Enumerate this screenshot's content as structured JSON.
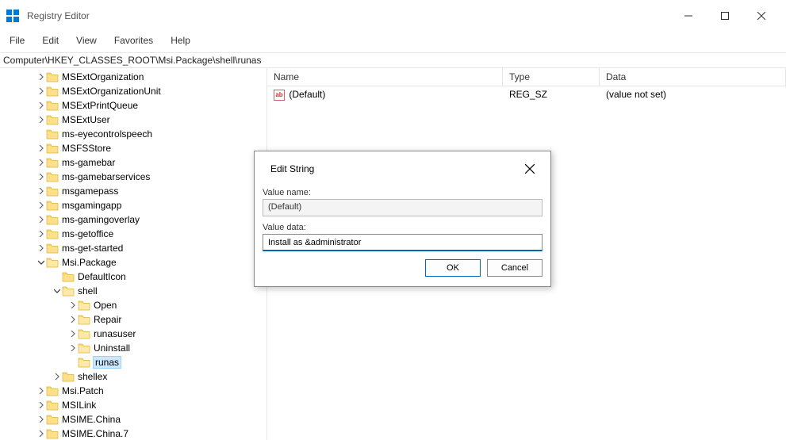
{
  "window": {
    "title": "Registry Editor"
  },
  "menu": {
    "file": "File",
    "edit": "Edit",
    "view": "View",
    "favorites": "Favorites",
    "help": "Help"
  },
  "address": "Computer\\HKEY_CLASSES_ROOT\\Msi.Package\\shell\\runas",
  "tree": {
    "items": [
      {
        "label": "MSExtOrganization",
        "indent": 46,
        "expander": ">"
      },
      {
        "label": "MSExtOrganizationUnit",
        "indent": 46,
        "expander": ">"
      },
      {
        "label": "MSExtPrintQueue",
        "indent": 46,
        "expander": ">"
      },
      {
        "label": "MSExtUser",
        "indent": 46,
        "expander": ">"
      },
      {
        "label": "ms-eyecontrolspeech",
        "indent": 46,
        "expander": ""
      },
      {
        "label": "MSFSStore",
        "indent": 46,
        "expander": ">"
      },
      {
        "label": "ms-gamebar",
        "indent": 46,
        "expander": ">"
      },
      {
        "label": "ms-gamebarservices",
        "indent": 46,
        "expander": ">"
      },
      {
        "label": "msgamepass",
        "indent": 46,
        "expander": ">"
      },
      {
        "label": "msgamingapp",
        "indent": 46,
        "expander": ">"
      },
      {
        "label": "ms-gamingoverlay",
        "indent": 46,
        "expander": ">"
      },
      {
        "label": "ms-getoffice",
        "indent": 46,
        "expander": ">"
      },
      {
        "label": "ms-get-started",
        "indent": 46,
        "expander": ">"
      },
      {
        "label": "Msi.Package",
        "indent": 46,
        "expander": "v",
        "open": true
      },
      {
        "label": "DefaultIcon",
        "indent": 66,
        "expander": ""
      },
      {
        "label": "shell",
        "indent": 66,
        "expander": "v",
        "open": true
      },
      {
        "label": "Open",
        "indent": 86,
        "expander": ">",
        "open": true
      },
      {
        "label": "Repair",
        "indent": 86,
        "expander": ">",
        "open": true
      },
      {
        "label": "runasuser",
        "indent": 86,
        "expander": ">",
        "open": true
      },
      {
        "label": "Uninstall",
        "indent": 86,
        "expander": ">",
        "open": true
      },
      {
        "label": "runas",
        "indent": 86,
        "expander": "",
        "open": true,
        "selected": true
      },
      {
        "label": "shellex",
        "indent": 66,
        "expander": ">"
      },
      {
        "label": "Msi.Patch",
        "indent": 46,
        "expander": ">"
      },
      {
        "label": "MSILink",
        "indent": 46,
        "expander": ">"
      },
      {
        "label": "MSIME.China",
        "indent": 46,
        "expander": ">"
      },
      {
        "label": "MSIME.China.7",
        "indent": 46,
        "expander": ">"
      }
    ]
  },
  "list": {
    "headers": {
      "name": "Name",
      "type": "Type",
      "data": "Data"
    },
    "rows": [
      {
        "name": "(Default)",
        "type": "REG_SZ",
        "data": "(value not set)"
      }
    ]
  },
  "dialog": {
    "title": "Edit String",
    "value_name_label": "Value name:",
    "value_name": "(Default)",
    "value_data_label": "Value data:",
    "value_data": "Install as &administrator",
    "ok": "OK",
    "cancel": "Cancel"
  }
}
